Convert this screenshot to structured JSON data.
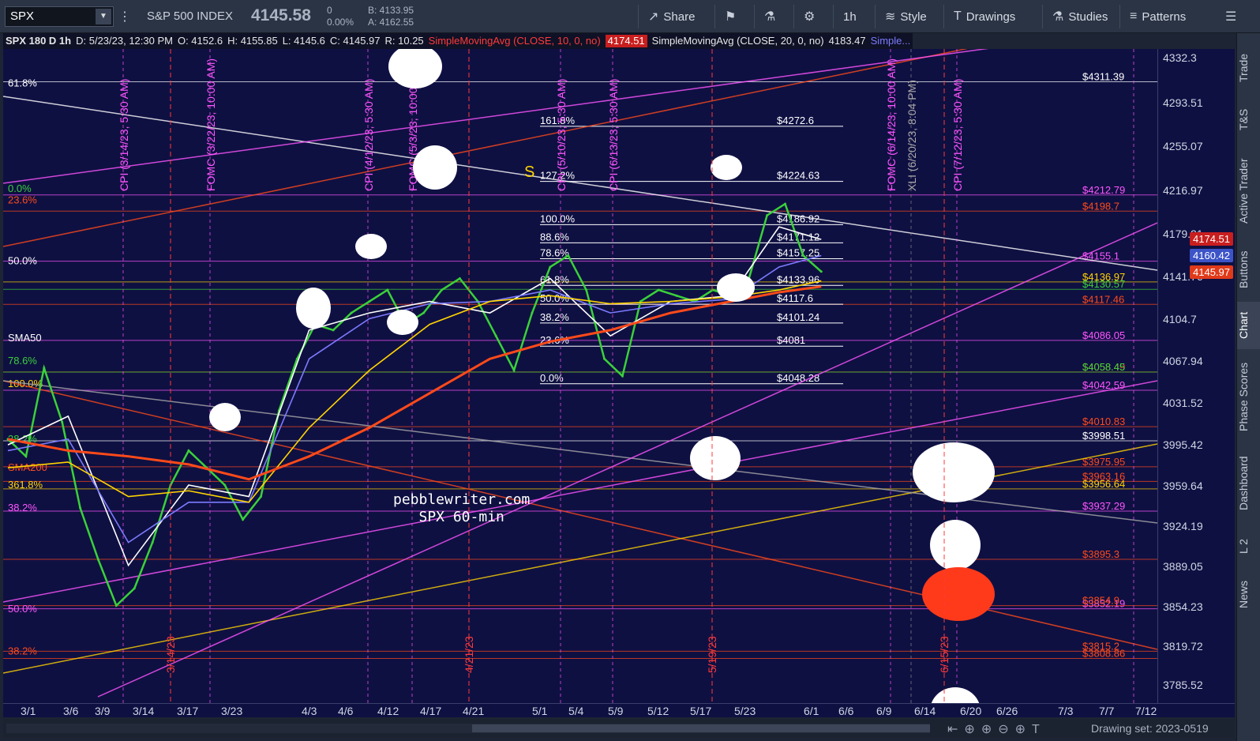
{
  "toolbar": {
    "symbol": "SPX",
    "index_name": "S&P 500 INDEX",
    "last_price": "4145.58",
    "change": "0",
    "change_pct": "0.00%",
    "bid": "B: 4133.95",
    "ask": "A: 4162.55",
    "share": "Share",
    "timeframe": "1h",
    "style": "Style",
    "drawings": "Drawings",
    "studies": "Studies",
    "patterns": "Patterns"
  },
  "info_bar": {
    "title": "SPX 180 D 1h",
    "date": "D: 5/23/23, 12:30 PM",
    "open": "O: 4152.6",
    "high": "H: 4155.85",
    "low": "L: 4145.6",
    "close": "C: 4145.97",
    "range": "R: 10.25",
    "sma10_label": "SimpleMovingAvg (CLOSE, 10, 0, no)",
    "sma10_value": "4174.51",
    "sma20_label": "SimpleMovingAvg (CLOSE, 20, 0, no)",
    "sma20_value": "4183.47",
    "more": "Simple..."
  },
  "side_tabs": [
    "Trade",
    "T&S",
    "Active Trader",
    "Buttons",
    "Chart",
    "Phase Scores",
    "Dashboard",
    "L 2",
    "News"
  ],
  "active_side_tab": "Chart",
  "status": {
    "drawing_set": "Drawing set: 2023-0519"
  },
  "watermark": {
    "line1": "pebblewriter.com",
    "line2": "SPX 60-min"
  },
  "marker_s": "S",
  "chart_data": {
    "type": "line",
    "title": "SPX 180 D 1h",
    "ylim": [
      3770,
      4340
    ],
    "x_ticks": [
      "3/1",
      "3/6",
      "3/9",
      "3/14",
      "3/17",
      "3/23",
      "4/3",
      "4/6",
      "4/12",
      "4/17",
      "4/21",
      "5/1",
      "5/4",
      "5/9",
      "5/12",
      "5/17",
      "5/23",
      "6/1",
      "6/6",
      "6/9",
      "6/14",
      "6/20",
      "6/26",
      "7/3",
      "7/7",
      "7/12"
    ],
    "y_ticks": [
      4332.3,
      4293.51,
      4255.07,
      4216.97,
      4179.21,
      4141.76,
      4104.7,
      4067.94,
      4031.52,
      3995.42,
      3959.64,
      3924.19,
      3889.05,
      3854.23,
      3819.72,
      3785.52
    ],
    "price_tags": [
      {
        "value": "4174.51",
        "color": "#c81e1e"
      },
      {
        "value": "4160.42",
        "color": "#3c54c8"
      },
      {
        "value": "4145.97",
        "color": "#e03a1a"
      }
    ],
    "series": [
      {
        "name": "SPX",
        "color": "#3ad13a",
        "values": [
          [
            0,
            4000
          ],
          [
            3,
            3985
          ],
          [
            6,
            4062
          ],
          [
            9,
            4015
          ],
          [
            12,
            3940
          ],
          [
            15,
            3895
          ],
          [
            18,
            3855
          ],
          [
            21,
            3870
          ],
          [
            24,
            3910
          ],
          [
            27,
            3960
          ],
          [
            30,
            3990
          ],
          [
            33,
            3975
          ],
          [
            36,
            3960
          ],
          [
            39,
            3930
          ],
          [
            42,
            3950
          ],
          [
            45,
            4025
          ],
          [
            48,
            4070
          ],
          [
            51,
            4100
          ],
          [
            54,
            4095
          ],
          [
            57,
            4110
          ],
          [
            60,
            4120
          ],
          [
            63,
            4130
          ],
          [
            66,
            4100
          ],
          [
            69,
            4110
          ],
          [
            72,
            4130
          ],
          [
            75,
            4140
          ],
          [
            78,
            4120
          ],
          [
            81,
            4090
          ],
          [
            84,
            4060
          ],
          [
            87,
            4110
          ],
          [
            90,
            4150
          ],
          [
            93,
            4160
          ],
          [
            96,
            4130
          ],
          [
            99,
            4070
          ],
          [
            102,
            4055
          ],
          [
            105,
            4120
          ],
          [
            108,
            4130
          ],
          [
            111,
            4125
          ],
          [
            114,
            4120
          ],
          [
            117,
            4130
          ],
          [
            120,
            4125
          ],
          [
            123,
            4140
          ],
          [
            126,
            4195
          ],
          [
            129,
            4205
          ],
          [
            132,
            4160
          ],
          [
            135,
            4146
          ]
        ]
      },
      {
        "name": "SMA 10",
        "color": "#ffffff",
        "values": [
          [
            0,
            3995
          ],
          [
            10,
            4020
          ],
          [
            20,
            3890
          ],
          [
            30,
            3960
          ],
          [
            40,
            3950
          ],
          [
            50,
            4095
          ],
          [
            60,
            4110
          ],
          [
            70,
            4120
          ],
          [
            80,
            4110
          ],
          [
            90,
            4140
          ],
          [
            100,
            4090
          ],
          [
            110,
            4120
          ],
          [
            120,
            4125
          ],
          [
            128,
            4185
          ],
          [
            135,
            4174
          ]
        ]
      },
      {
        "name": "SMA 20",
        "color": "#7b7bff",
        "values": [
          [
            0,
            3990
          ],
          [
            10,
            4000
          ],
          [
            20,
            3910
          ],
          [
            30,
            3945
          ],
          [
            40,
            3945
          ],
          [
            50,
            4070
          ],
          [
            60,
            4105
          ],
          [
            70,
            4118
          ],
          [
            80,
            4120
          ],
          [
            90,
            4130
          ],
          [
            100,
            4110
          ],
          [
            110,
            4118
          ],
          [
            120,
            4122
          ],
          [
            128,
            4150
          ],
          [
            135,
            4160
          ]
        ]
      },
      {
        "name": "SMA 50",
        "color": "#ffd400",
        "values": [
          [
            0,
            3975
          ],
          [
            10,
            3980
          ],
          [
            20,
            3950
          ],
          [
            30,
            3955
          ],
          [
            40,
            3945
          ],
          [
            50,
            4010
          ],
          [
            60,
            4060
          ],
          [
            70,
            4100
          ],
          [
            80,
            4120
          ],
          [
            90,
            4125
          ],
          [
            100,
            4118
          ],
          [
            110,
            4120
          ],
          [
            120,
            4124
          ],
          [
            128,
            4130
          ],
          [
            135,
            4138
          ]
        ]
      },
      {
        "name": "SMA 200",
        "color": "#ff4a1a",
        "values": [
          [
            0,
            4000
          ],
          [
            10,
            3990
          ],
          [
            20,
            3985
          ],
          [
            30,
            3978
          ],
          [
            40,
            3965
          ],
          [
            50,
            3985
          ],
          [
            60,
            4010
          ],
          [
            70,
            4040
          ],
          [
            80,
            4070
          ],
          [
            90,
            4085
          ],
          [
            100,
            4095
          ],
          [
            110,
            4110
          ],
          [
            120,
            4120
          ],
          [
            128,
            4128
          ],
          [
            135,
            4133
          ]
        ]
      }
    ],
    "fib_levels": [
      {
        "pct": "161.8%",
        "value": "$4272.6",
        "color": "#ffffff"
      },
      {
        "pct": "127.2%",
        "value": "$4224.63",
        "color": "#ffffff"
      },
      {
        "pct": "100.0%",
        "value": "$4186.92",
        "color": "#ffffff"
      },
      {
        "pct": "88.6%",
        "value": "$4171.12",
        "color": "#ffffff"
      },
      {
        "pct": "78.6%",
        "value": "$4157.25",
        "color": "#ffffff"
      },
      {
        "pct": "61.8%",
        "value": "$4133.96",
        "color": "#ffffff"
      },
      {
        "pct": "50.0%",
        "value": "$4117.6",
        "color": "#ffffff"
      },
      {
        "pct": "38.2%",
        "value": "$4101.24",
        "color": "#ffffff"
      },
      {
        "pct": "23.6%",
        "value": "$4081",
        "color": "#ffffff"
      },
      {
        "pct": "0.0%",
        "value": "$4048.28",
        "color": "#ffffff"
      }
    ],
    "right_levels": [
      {
        "value": "$4311.39",
        "price": 4311.39,
        "color": "#ffffff"
      },
      {
        "value": "$4212.79",
        "price": 4212.79,
        "color": "#ff55ff"
      },
      {
        "value": "$4198.7",
        "price": 4198.7,
        "color": "#ff4a1a"
      },
      {
        "value": "$4155.1",
        "price": 4155.1,
        "color": "#ff55ff"
      },
      {
        "value": "$4136.97",
        "price": 4136.97,
        "color": "#ffd400"
      },
      {
        "value": "$4130.57",
        "price": 4130.57,
        "color": "#3ad13a"
      },
      {
        "value": "$4117.46",
        "price": 4117.46,
        "color": "#ff4a1a"
      },
      {
        "value": "$4086.05",
        "price": 4086.05,
        "color": "#ff55ff"
      },
      {
        "value": "$4058.49",
        "price": 4058.49,
        "color": "#ff4a1a"
      },
      {
        "value": "$4058.45",
        "price": 4058.45,
        "color": "#3ad13a"
      },
      {
        "value": "$4042.59",
        "price": 4042.59,
        "color": "#ff55ff"
      },
      {
        "value": "$4010.83",
        "price": 4010.83,
        "color": "#ff4a1a"
      },
      {
        "value": "$3998.51",
        "price": 3998.51,
        "color": "#ffffff"
      },
      {
        "value": "$3975.95",
        "price": 3975.95,
        "color": "#ff4a1a"
      },
      {
        "value": "$3963.16",
        "price": 3963.16,
        "color": "#ff4a1a"
      },
      {
        "value": "$3956.64",
        "price": 3956.64,
        "color": "#ffd400"
      },
      {
        "value": "$3937.29",
        "price": 3937.29,
        "color": "#ff55ff"
      },
      {
        "value": "$3895.3",
        "price": 3895.3,
        "color": "#ff4a1a"
      },
      {
        "value": "$3852.19",
        "price": 3852.19,
        "color": "#ff55ff"
      },
      {
        "value": "$3854.9",
        "price": 3854.9,
        "color": "#ff4a1a"
      },
      {
        "value": "$3815.2",
        "price": 3815.2,
        "color": "#ff4a1a"
      },
      {
        "value": "$3808.86",
        "price": 3808.86,
        "color": "#ff4a1a"
      }
    ],
    "left_levels": [
      {
        "label": "61.8%",
        "price": 4310,
        "color": "#ffffff"
      },
      {
        "label": "0.0%",
        "price": 4218,
        "color": "#3ad13a"
      },
      {
        "label": "23.6%",
        "price": 4208,
        "color": "#ff4a1a"
      },
      {
        "label": "50.0%",
        "price": 4155,
        "color": "#ffffff"
      },
      {
        "label": "SMA50",
        "price": 4088,
        "color": "#ffffff"
      },
      {
        "label": "78.6%",
        "price": 4068,
        "color": "#3ad13a"
      },
      {
        "label": "100.0%",
        "price": 4048,
        "color": "#ffd400"
      },
      {
        "label": "38.2%",
        "price": 4000,
        "color": "#3ad13a"
      },
      {
        "label": "SMA200",
        "price": 3975,
        "color": "#ff4a1a"
      },
      {
        "label": "361.8%",
        "price": 3960,
        "color": "#ffd400"
      },
      {
        "label": "38.2%",
        "price": 3940,
        "color": "#ff55ff"
      },
      {
        "label": "50.0%",
        "price": 3852,
        "color": "#ff55ff"
      },
      {
        "label": "38.2%",
        "price": 3815,
        "color": "#ff4a1a"
      }
    ],
    "event_labels": [
      {
        "text": "CPI (3/14/23, 5:30 AM)",
        "color": "#ff55ff"
      },
      {
        "text": "FOMC (3/22/23, 10:00 AM)",
        "color": "#ff55ff"
      },
      {
        "text": "CPI (4/12/23, 5:30 AM)",
        "color": "#ff55ff"
      },
      {
        "text": "FOMC (5/3/23, 10:00 AM)",
        "color": "#ff55ff"
      },
      {
        "text": "CPI (5/10/23, 5:30 AM)",
        "color": "#ff55ff"
      },
      {
        "text": "CPI (6/13/23, 5:30 AM)",
        "color": "#ff55ff"
      },
      {
        "text": "FOMC (6/14/23, 10:00 AM)",
        "color": "#ff55ff"
      },
      {
        "text": "XLI (6/20/23, 8:04 PM)",
        "color": "#aaaaaa"
      },
      {
        "text": "CPI (7/12/23, 5:30 AM)",
        "color": "#ff55ff"
      }
    ],
    "date_markers": [
      "3/14/23",
      "4/21/23",
      "5/19/23",
      "6/15/23"
    ]
  }
}
